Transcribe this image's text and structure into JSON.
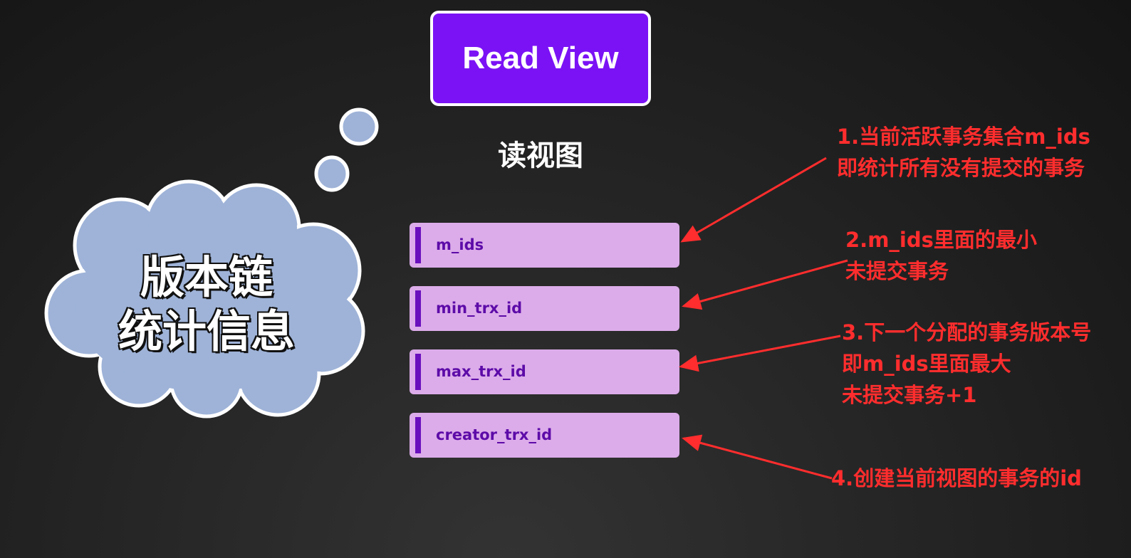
{
  "header": {
    "title": "Read View",
    "subtitle": "读视图"
  },
  "cloud": {
    "lines": [
      "版本链",
      "统计信息"
    ]
  },
  "fields": [
    "m_ids",
    "min_trx_id",
    "max_trx_id",
    "creator_trx_id"
  ],
  "annotations": [
    {
      "lines": [
        "1.当前活跃事务集合m_ids",
        "即统计所有没有提交的事务"
      ]
    },
    {
      "lines": [
        "2.m_ids里面的最小",
        "未提交事务"
      ]
    },
    {
      "lines": [
        "3.下一个分配的事务版本号",
        "即m_ids里面最大",
        "未提交事务+1"
      ]
    },
    {
      "lines": [
        "4.创建当前视图的事务的id"
      ]
    }
  ],
  "colors": {
    "title_bg": "#7b12f5",
    "field_bg": "#dcacea",
    "field_text": "#5d0ba8",
    "annotation": "#ff2d2d",
    "cloud": "#9fb3d8"
  }
}
